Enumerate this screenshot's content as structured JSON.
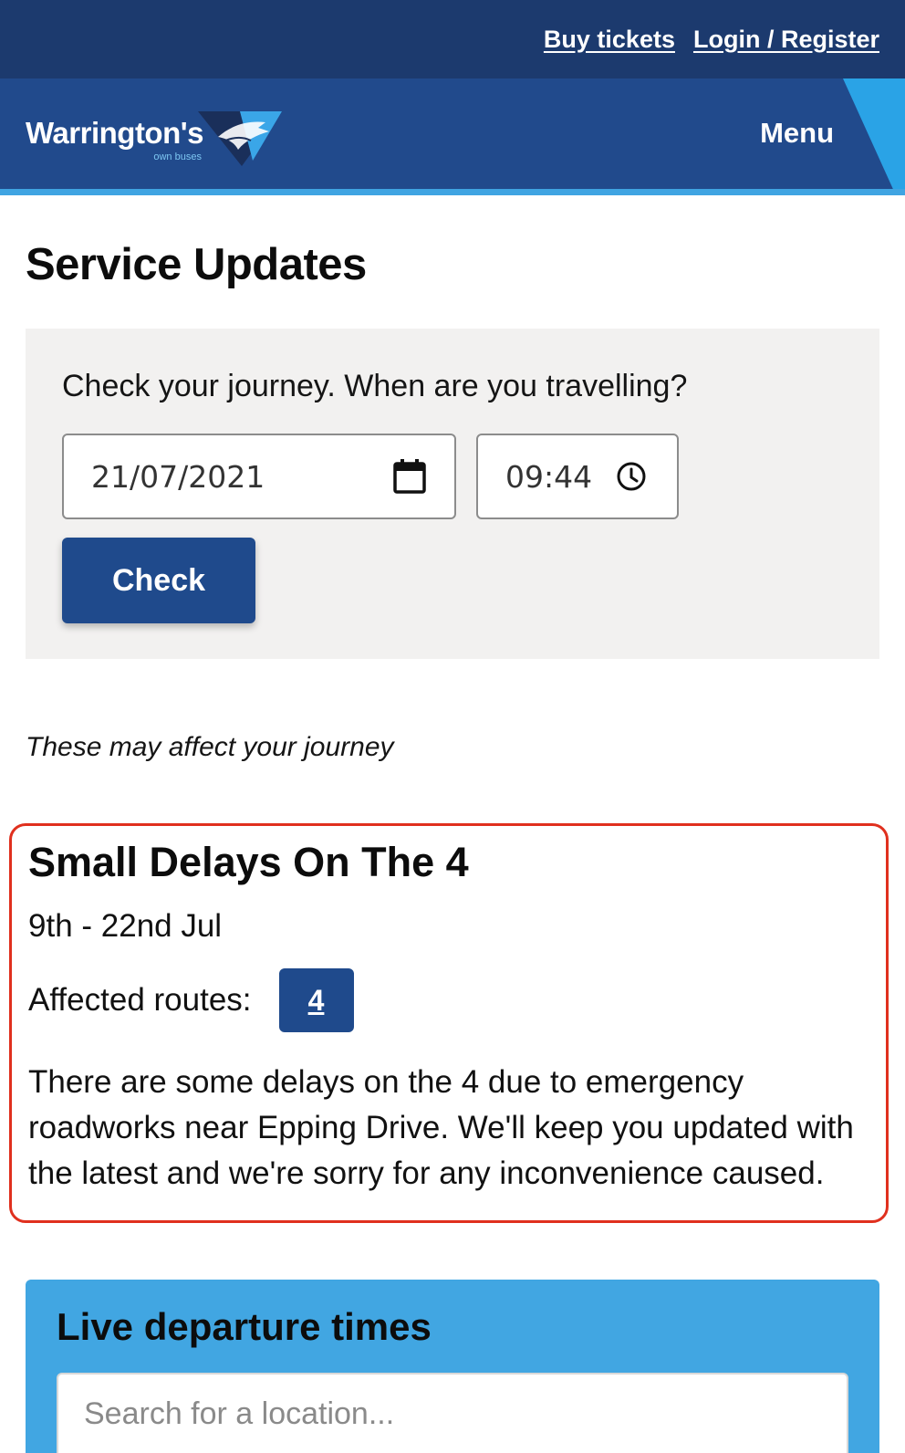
{
  "top_links": {
    "buy_tickets": "Buy tickets",
    "login": "Login / Register"
  },
  "header": {
    "logo_text": "Warrington's",
    "logo_sub": "own buses",
    "menu": "Menu"
  },
  "page": {
    "title": "Service Updates"
  },
  "journey_check": {
    "prompt": "Check your journey. When are you travelling?",
    "date_value": "21/07/2021",
    "time_value": "09:44",
    "check_label": "Check"
  },
  "affect_note": "These may affect your journey",
  "alert": {
    "title": "Small Delays On The 4",
    "dates": "9th - 22nd Jul",
    "affected_label": "Affected routes:",
    "routes": [
      "4"
    ],
    "description": "There are some delays on the 4 due to emergency roadworks near Epping Drive. We'll keep you updated with the latest and we're sorry for any inconvenience caused."
  },
  "live": {
    "title": "Live departure times",
    "search_placeholder": "Search for a location..."
  },
  "colors": {
    "navy": "#1c3a6e",
    "header_blue": "#214a8c",
    "light_blue": "#41a6e2",
    "alert_red": "#e0301e",
    "button_blue": "#1f4a8c"
  }
}
